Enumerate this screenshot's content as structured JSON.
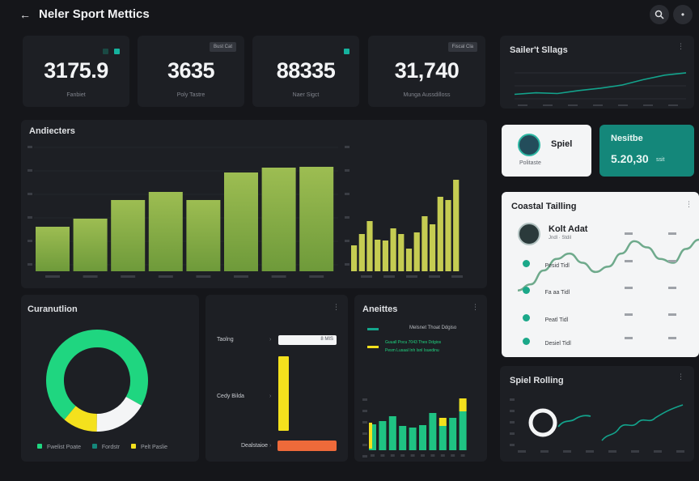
{
  "header": {
    "title": "Neler Sport Mettics",
    "back_icon": "arrow-left-icon",
    "search_icon": "search-icon",
    "menu_icon": "dot-menu-icon"
  },
  "kpis": [
    {
      "value": "3175.9",
      "label": "Fanbiet",
      "tag": ""
    },
    {
      "value": "3635",
      "label": "Poly Tastre",
      "tag": "Bust Cat"
    },
    {
      "value": "88335",
      "label": "Naer Sigct",
      "tag": ""
    },
    {
      "value": "31,740",
      "label": "Munga Aussdilloss",
      "tag": "Fiscal Cla"
    }
  ],
  "sales": {
    "title": "Sailer't Sllags"
  },
  "audience": {
    "title": "Andiecters"
  },
  "profile": {
    "name": "Spiel",
    "sub": "Politaste"
  },
  "highlight": {
    "title": "Nesitbe",
    "value": "5.20,30",
    "unit": "ssit"
  },
  "coach": {
    "title": "Coastal Tailling",
    "name": "Kolt Adat",
    "meta": "Jndl · Stdil",
    "items": [
      {
        "label": "Pesid Tidl"
      },
      {
        "label": "Fa aa Tidl"
      },
      {
        "label": "Peatl Tidl"
      },
      {
        "label": "Desiel Tidl"
      }
    ]
  },
  "conversion": {
    "title": "Curanutlion",
    "legend": [
      "Fwelist Poate",
      "Fordstr",
      "Pelt Paslie"
    ]
  },
  "metrics": {
    "items": [
      {
        "label": "Taolng",
        "value": "8 MIS"
      },
      {
        "label": "Cedy Bilda"
      },
      {
        "label": "Dealstaioe"
      }
    ]
  },
  "analytics": {
    "title": "Aneittes",
    "legend": [
      "Melsnet Thoat Ddgiso",
      "Guuall Pocu 7043 Thes Ddgios",
      "Pesm Lusaal Inh Isnl Isuedinu"
    ]
  },
  "spiel": {
    "title": "Spiel Rolling"
  },
  "colors": {
    "bg": "#15161a",
    "panel": "#1d1f24",
    "teal": "#14877a",
    "green": "#1fd680",
    "yellow": "#f4e11d",
    "olive": "#8db04c",
    "orange": "#ee6a3a",
    "lime": "#c5cc52"
  },
  "chart_data": [
    {
      "type": "bar",
      "name": "audience-bars",
      "values": [
        55,
        65,
        88,
        98,
        88,
        122,
        128,
        129
      ]
    },
    {
      "type": "bar",
      "name": "audience-mini-bars",
      "values": [
        32,
        46,
        62,
        39,
        38,
        53,
        46,
        28,
        48,
        68,
        58,
        92,
        88,
        113
      ]
    },
    {
      "type": "line",
      "name": "sales-trend",
      "values": [
        1,
        1.2,
        1.1,
        1.5,
        1.8,
        2.2,
        2.9,
        3.5,
        3.8
      ]
    },
    {
      "type": "pie",
      "name": "conversion-donut",
      "values": [
        72,
        17,
        11
      ]
    },
    {
      "type": "bar",
      "name": "analytics-bars",
      "values": [
        32,
        36,
        42,
        30,
        28,
        31,
        46,
        33,
        40,
        60
      ]
    },
    {
      "type": "line",
      "name": "coach-wave",
      "values": [
        14,
        22,
        40,
        55,
        62,
        50,
        38,
        45,
        62,
        78,
        70,
        55,
        50,
        68,
        80
      ]
    }
  ]
}
